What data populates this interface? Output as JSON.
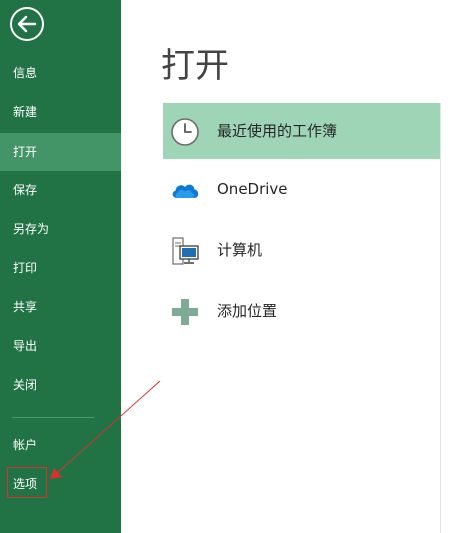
{
  "sidebar": {
    "back_icon": "back-arrow-icon",
    "items": [
      {
        "label": "信息"
      },
      {
        "label": "新建"
      },
      {
        "label": "打开"
      },
      {
        "label": "保存"
      },
      {
        "label": "另存为"
      },
      {
        "label": "打印"
      },
      {
        "label": "共享"
      },
      {
        "label": "导出"
      },
      {
        "label": "关闭"
      },
      {
        "label": "帐户"
      },
      {
        "label": "选项"
      }
    ],
    "active_item": "打开",
    "highlighted_item": "选项"
  },
  "main": {
    "title": "打开",
    "locations": [
      {
        "label": "最近使用的工作簿",
        "icon": "clock-icon",
        "selected": true
      },
      {
        "label": "OneDrive",
        "icon": "cloud-icon",
        "selected": false
      },
      {
        "label": "计算机",
        "icon": "computer-icon",
        "selected": false
      },
      {
        "label": "添加位置",
        "icon": "plus-icon",
        "selected": false
      }
    ]
  },
  "colors": {
    "sidebar_bg": "#217346",
    "sidebar_active": "#439467",
    "selected_location": "#9fd5b7",
    "annotation": "#d9322b"
  }
}
